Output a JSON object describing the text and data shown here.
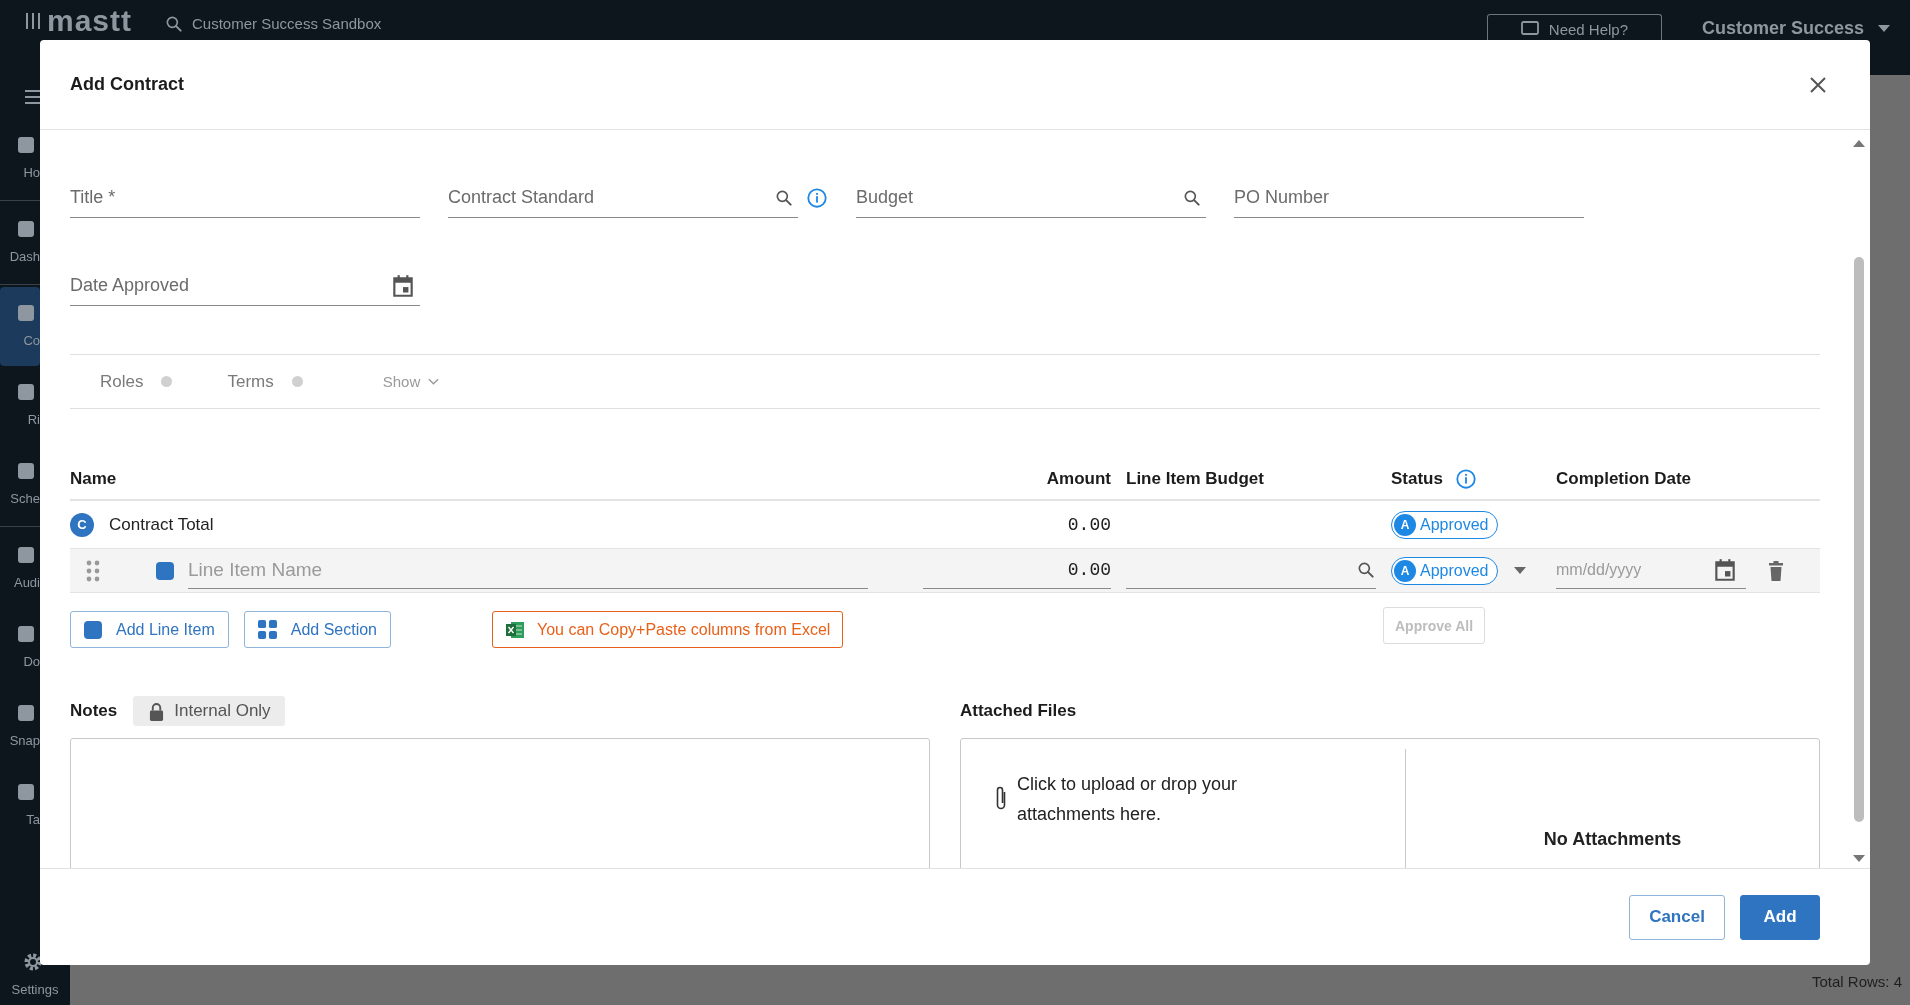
{
  "app": {
    "logo": "mastt",
    "search": "Customer Success Sandbox",
    "help_button": "Need Help?",
    "account": "Customer Success",
    "sidebar": [
      {
        "label": "Ho",
        "selected": false
      },
      {
        "label": "Dash",
        "selected": false
      },
      {
        "label": "Co",
        "selected": true
      },
      {
        "label": "Ri",
        "selected": false
      },
      {
        "label": "Sche",
        "selected": false
      },
      {
        "label": "Audi",
        "selected": false
      },
      {
        "label": "Do",
        "selected": false
      },
      {
        "label": "Snap",
        "selected": false
      },
      {
        "label": "Ta",
        "selected": false
      }
    ],
    "settings": "Settings",
    "total_rows": "Total Rows: 4"
  },
  "dialog": {
    "title": "Add Contract",
    "fields": [
      {
        "placeholder": "Title *",
        "kind": "text"
      },
      {
        "placeholder": "Contract Standard",
        "kind": "search",
        "info": true
      },
      {
        "placeholder": "Budget",
        "kind": "search",
        "info": false
      },
      {
        "placeholder": "PO Number",
        "kind": "text"
      },
      {
        "placeholder": "Date Approved",
        "kind": "date"
      }
    ],
    "tabs": [
      {
        "label": "Roles",
        "kind": "tab",
        "selected": false
      },
      {
        "label": "Terms",
        "kind": "tab",
        "selected": false
      },
      {
        "label": "Show",
        "kind": "menu",
        "selected": false
      }
    ],
    "table": {
      "columns": [
        "Name",
        "Amount",
        "Line Item Budget",
        "Status",
        "Completion Date"
      ],
      "total_row": {
        "badge": "C",
        "name": "Contract Total",
        "amount": "0.00",
        "status_badge": "A",
        "status": "Approved"
      },
      "line_rows": [
        {
          "placeholder": "Line Item Name",
          "amount": "0.00",
          "status_badge": "A",
          "status": "Approved",
          "date_placeholder": "mm/dd/yyyy"
        }
      ]
    },
    "add_buttons": [
      {
        "label": "Add Line Item",
        "kind": "line"
      },
      {
        "label": "Add Section",
        "kind": "section"
      }
    ],
    "excel_hint": "You can Copy+Paste columns from Excel",
    "approve_all": {
      "label": "Approve All",
      "disabled": true
    },
    "notes": {
      "label": "Notes",
      "visibility": "Internal Only"
    },
    "files": {
      "label": "Attached Files",
      "upload": "Click to upload or drop your attachments here.",
      "empty": "No Attachments"
    },
    "footer_buttons": [
      {
        "label": "Cancel",
        "kind": "secondary"
      },
      {
        "label": "Add",
        "kind": "primary"
      }
    ]
  }
}
